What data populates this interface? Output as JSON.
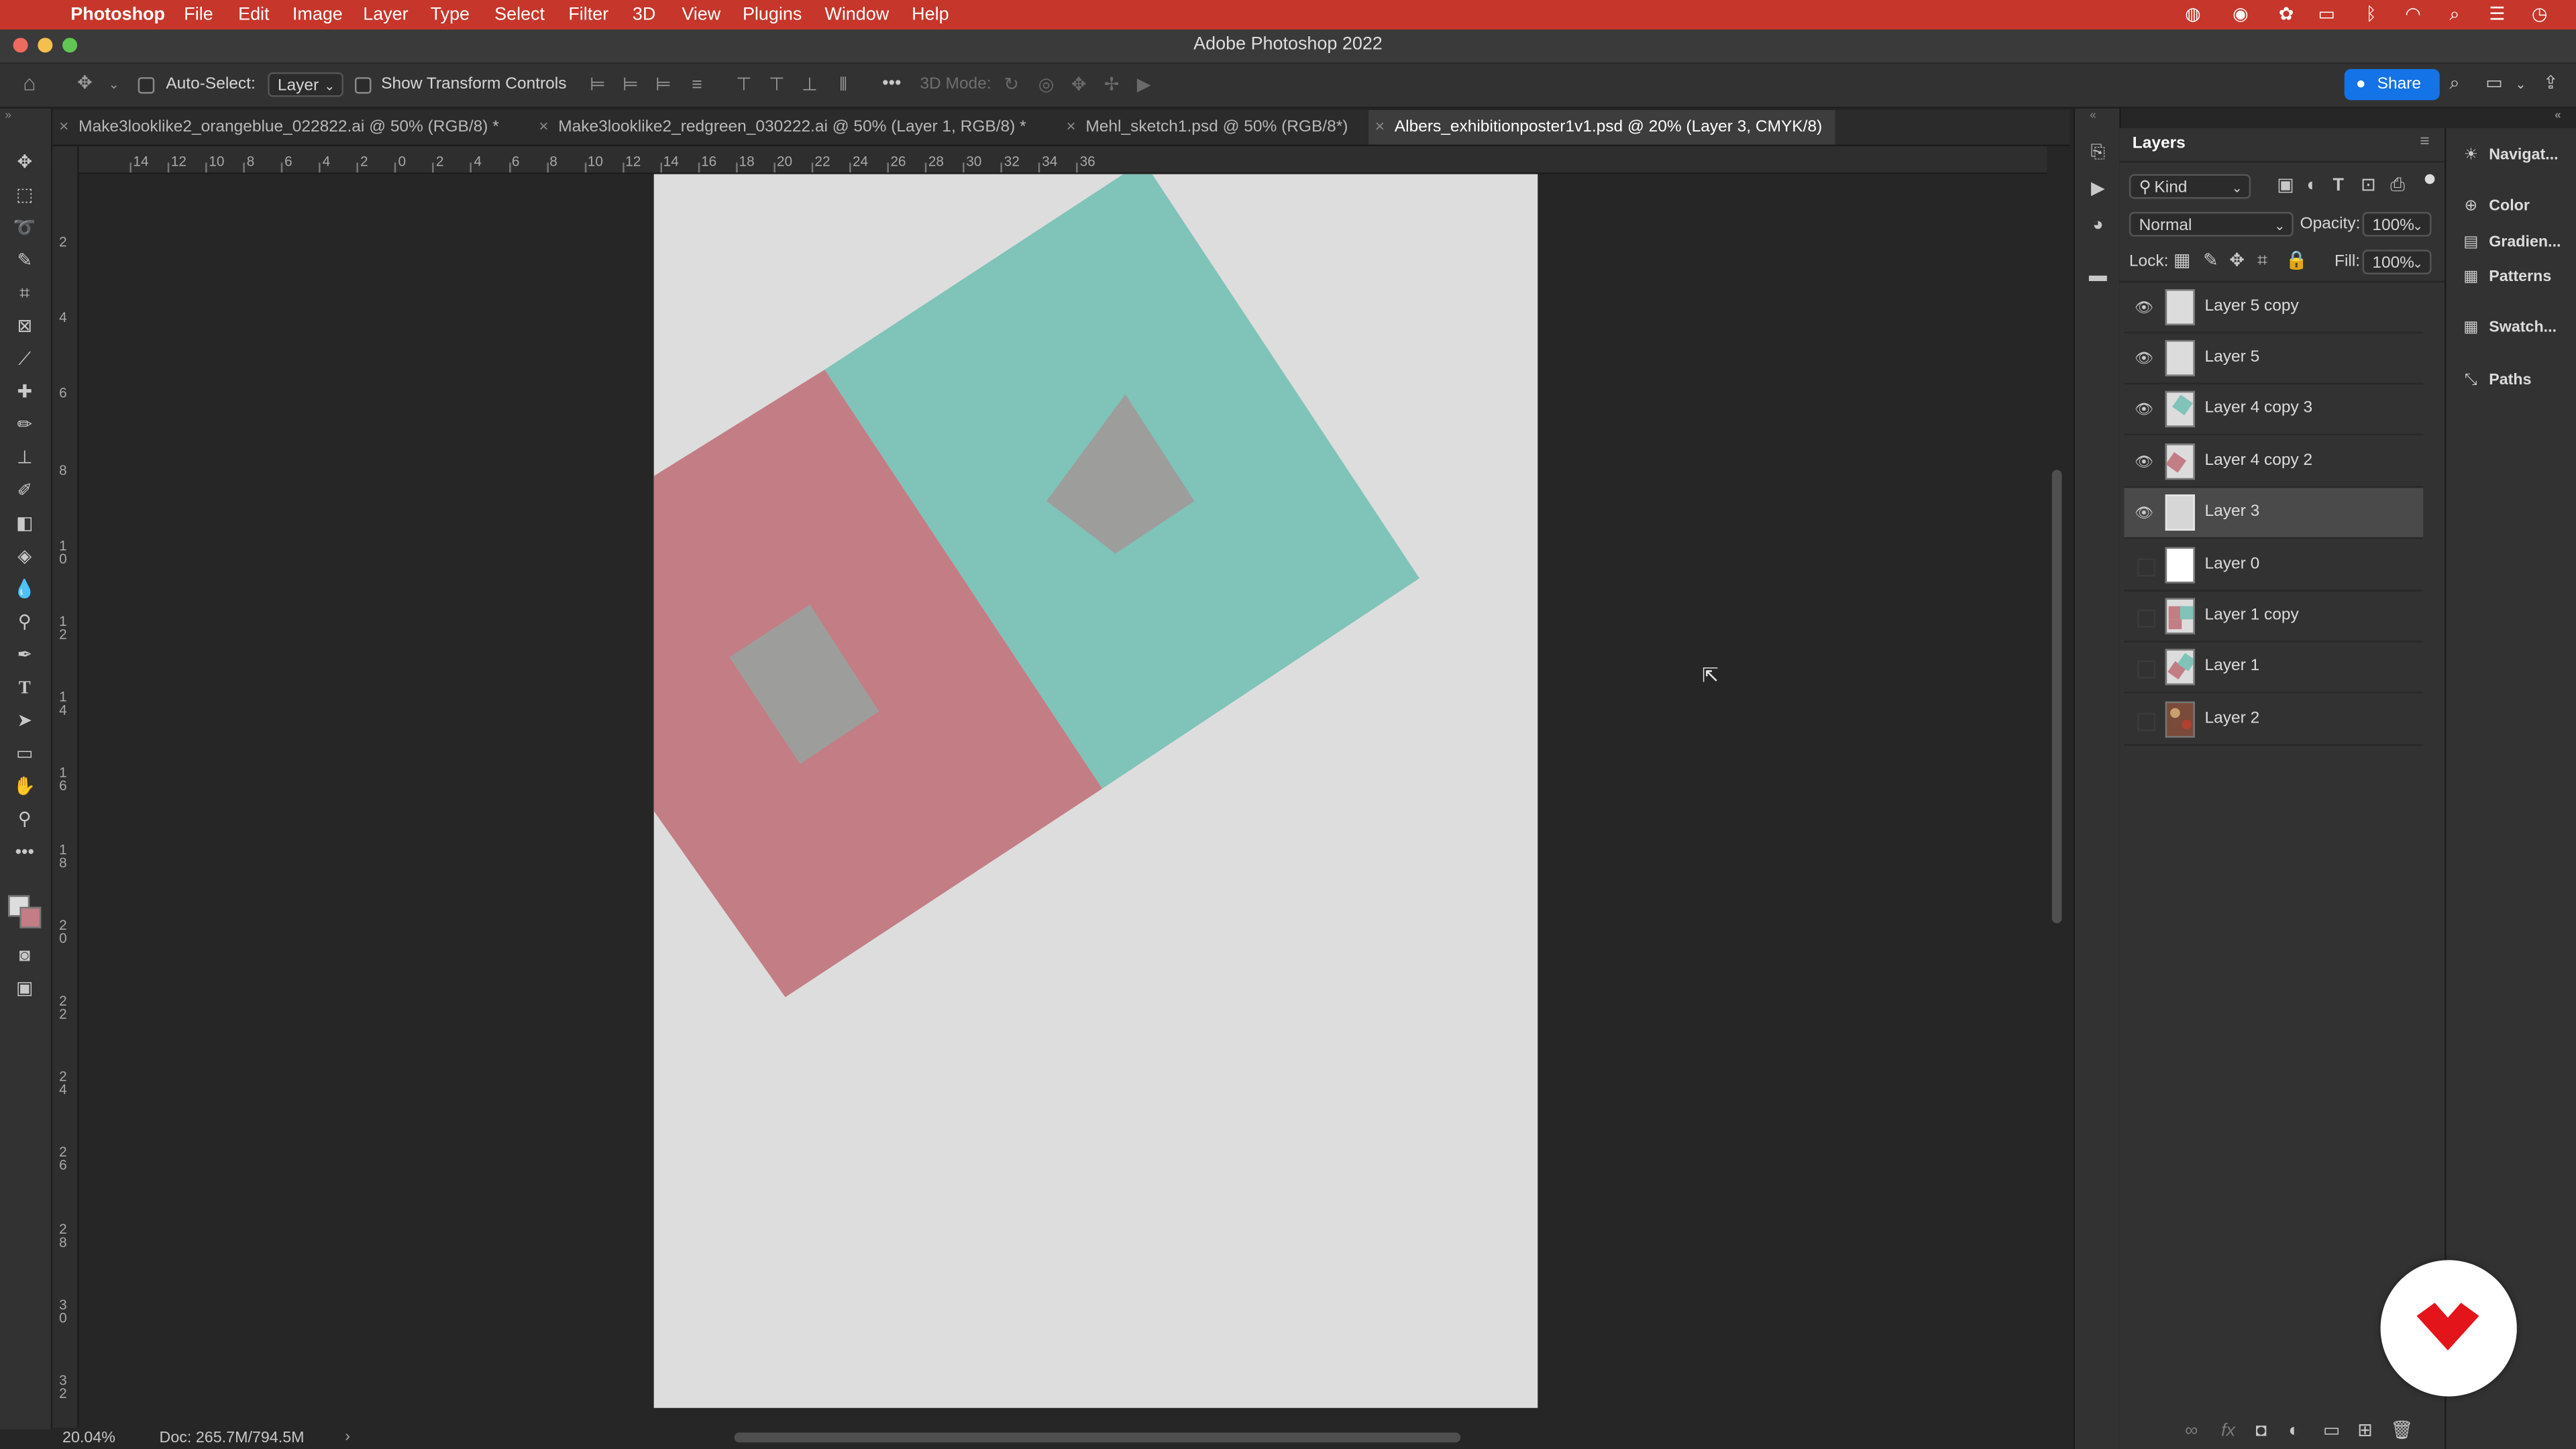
{
  "menubar": {
    "app_name": "Photoshop",
    "items": [
      "File",
      "Edit",
      "Image",
      "Layer",
      "Type",
      "Select",
      "Filter",
      "3D",
      "View",
      "Plugins",
      "Window",
      "Help"
    ]
  },
  "window": {
    "title": "Adobe Photoshop 2022"
  },
  "options_bar": {
    "auto_select_label": "Auto-Select:",
    "auto_select_value": "Layer",
    "show_transform_label": "Show Transform Controls",
    "three_d_mode_label": "3D Mode:",
    "share_label": "Share"
  },
  "tabs": [
    {
      "label": "Make3looklike2_orangeblue_022822.ai @ 50% (RGB/8) *",
      "active": false
    },
    {
      "label": "Make3looklike2_redgreen_030222.ai @ 50% (Layer 1, RGB/8) *",
      "active": false
    },
    {
      "label": "Mehl_sketch1.psd @ 50% (RGB/8*)",
      "active": false
    },
    {
      "label": "Albers_exhibitionposter1v1.psd @ 20% (Layer 3, CMYK/8)",
      "active": true
    }
  ],
  "ruler": {
    "h_labels": [
      "14",
      "12",
      "10",
      "8",
      "6",
      "4",
      "2",
      "0",
      "2",
      "4",
      "6",
      "8",
      "10",
      "12",
      "14",
      "16",
      "18",
      "20",
      "22",
      "24",
      "26",
      "28",
      "30",
      "32",
      "34",
      "36"
    ],
    "v_labels": [
      "2",
      "4",
      "6",
      "8",
      "10",
      "12",
      "14",
      "16",
      "18",
      "20",
      "22",
      "24",
      "26",
      "28",
      "30",
      "32"
    ]
  },
  "layers_panel": {
    "title": "Layers",
    "filter_kind": "Kind",
    "blend_mode": "Normal",
    "opacity_label": "Opacity:",
    "opacity_value": "100%",
    "lock_label": "Lock:",
    "fill_label": "Fill:",
    "fill_value": "100%",
    "layers": [
      {
        "name": "Layer 5 copy",
        "visible": true,
        "selected": false,
        "thumb": "blank"
      },
      {
        "name": "Layer 5",
        "visible": true,
        "selected": false,
        "thumb": "blank"
      },
      {
        "name": "Layer 4 copy 3",
        "visible": true,
        "selected": false,
        "thumb": "teal"
      },
      {
        "name": "Layer 4 copy 2",
        "visible": true,
        "selected": false,
        "thumb": "red"
      },
      {
        "name": "Layer 3",
        "visible": true,
        "selected": true,
        "thumb": "grey"
      },
      {
        "name": "Layer 0",
        "visible": false,
        "selected": false,
        "thumb": "white"
      },
      {
        "name": "Layer 1 copy",
        "visible": false,
        "selected": false,
        "thumb": "mixed"
      },
      {
        "name": "Layer 1",
        "visible": false,
        "selected": false,
        "thumb": "mixed2"
      },
      {
        "name": "Layer 2",
        "visible": false,
        "selected": false,
        "thumb": "photo"
      }
    ]
  },
  "right_panels": [
    "Navigat...",
    "Color",
    "Gradien...",
    "Patterns",
    "Swatch...",
    "Paths"
  ],
  "status_bar": {
    "zoom": "20.04%",
    "doc_size": "Doc: 265.7M/794.5M"
  },
  "colors": {
    "menubar": "#c6362a",
    "teal": "#80c3b9",
    "rose": "#c37d85",
    "inner_grey": "#9d9e9c",
    "canvas_bg": "#dddddd",
    "accent": "#1473e6"
  }
}
